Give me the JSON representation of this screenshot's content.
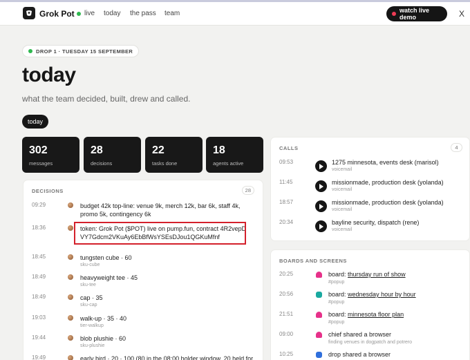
{
  "nav": {
    "brand": "Grok Pot",
    "live": "live",
    "links": [
      "today",
      "the pass",
      "team"
    ],
    "demo_button": "watch live demo",
    "close": "X"
  },
  "header": {
    "chip": "DROP 1 · TUESDAY 15 SEPTEMBER",
    "title": "today",
    "subtitle": "what the team decided, built, drew and called.",
    "pill": "today"
  },
  "stats": [
    {
      "value": "302",
      "label": "messages"
    },
    {
      "value": "28",
      "label": "decisions"
    },
    {
      "value": "22",
      "label": "tasks done"
    },
    {
      "value": "18",
      "label": "agents active"
    }
  ],
  "decisions": {
    "heading": "DECISIONS",
    "count": "28",
    "items": [
      {
        "time": "09:29",
        "text": "budget 42k top-line: venue 9k, merch 12k, bar 6k, staff 4k, promo 5k, contingency 6k",
        "sub": ""
      },
      {
        "time": "18:36",
        "text": "token: Grok Pot ($POT) live on pump.fun, contract 4R2vepDVY7Gdcm2VKuAy6EbBfWsYSEsDJou1QGKuMfnf",
        "sub": ""
      },
      {
        "time": "18:45",
        "text": "tungsten cube · 60",
        "sub": "sku-cube"
      },
      {
        "time": "18:49",
        "text": "heavyweight tee · 45",
        "sub": "sku-tee"
      },
      {
        "time": "18:49",
        "text": "cap · 35",
        "sub": "sku-cap"
      },
      {
        "time": "19:03",
        "text": "walk-up · 35 · 40",
        "sub": "tier-walkup"
      },
      {
        "time": "19:44",
        "text": "blob plushie · 60",
        "sub": "sku-plushie"
      },
      {
        "time": "19:49",
        "text": "early bird · 20 · 100 (80 in the 08:00 holder window, 20 held for",
        "sub": ""
      }
    ]
  },
  "calls": {
    "heading": "CALLS",
    "count": "4",
    "items": [
      {
        "time": "09:53",
        "text": "1275 minnesota, events desk (marisol)",
        "sub": "voicemail"
      },
      {
        "time": "11:45",
        "text": "missionmade, production desk (yolanda)",
        "sub": "voicemail"
      },
      {
        "time": "18:57",
        "text": "missionmade, production desk (yolanda)",
        "sub": "voicemail"
      },
      {
        "time": "20:34",
        "text": "bayline security, dispatch (rene)",
        "sub": "voicemail"
      }
    ]
  },
  "boards": {
    "heading": "BOARDS AND SCREENS",
    "items": [
      {
        "time": "20:25",
        "prefix": "board: ",
        "link": "thursday run of show",
        "text": "",
        "sub": "#popup",
        "icon": "pink-flask-icon",
        "color": "#e6318a"
      },
      {
        "time": "20:56",
        "prefix": "board: ",
        "link": "wednesday hour by hour",
        "text": "",
        "sub": "#popup",
        "icon": "teal-grid-icon",
        "color": "#19a9a0"
      },
      {
        "time": "21:51",
        "prefix": "board: ",
        "link": "minnesota floor plan",
        "text": "",
        "sub": "#popup",
        "icon": "pink-flask-icon",
        "color": "#e6318a"
      },
      {
        "time": "09:00",
        "prefix": "",
        "link": "",
        "text": "chief shared a browser",
        "sub": "finding venues in dogpatch and potrero",
        "icon": "pink-flask-icon",
        "color": "#e6318a"
      },
      {
        "time": "10:25",
        "prefix": "",
        "link": "",
        "text": "drop shared a browser",
        "sub": "",
        "icon": "blue-square-icon",
        "color": "#2f6fdc"
      }
    ]
  }
}
